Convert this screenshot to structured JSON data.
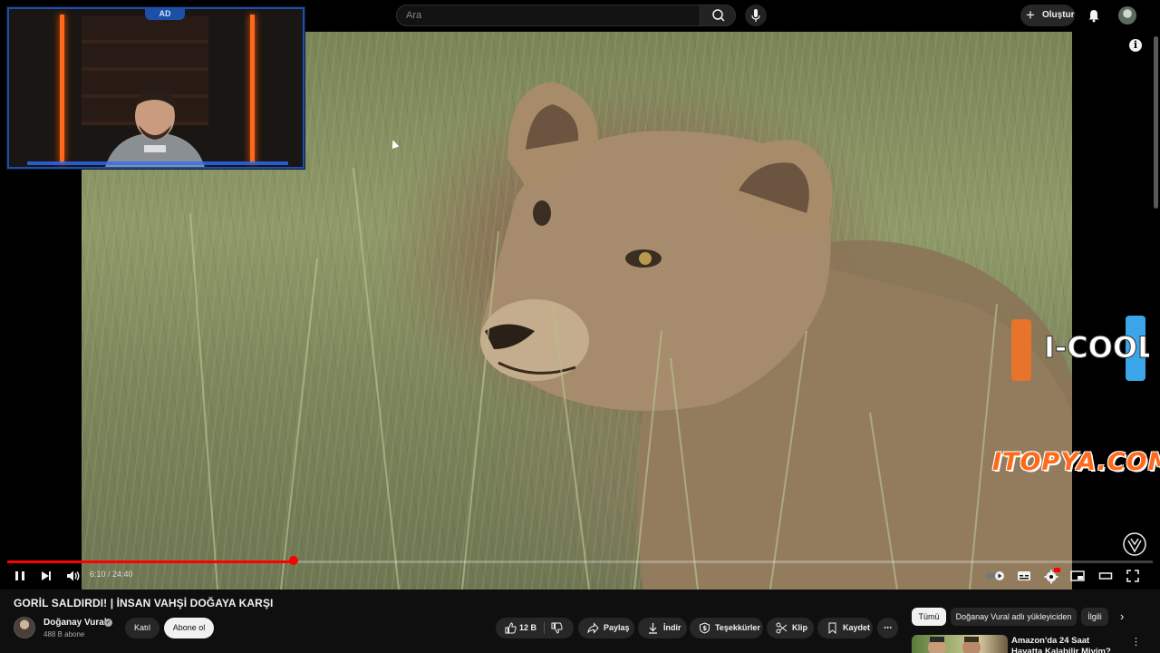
{
  "masthead": {
    "search_placeholder": "Ara",
    "create_label": "Oluştur",
    "create_icon": "plus-icon",
    "notifications_icon": "bell-icon"
  },
  "player": {
    "time_current": "6:10",
    "time_total": "24:40",
    "time_display": "6:10 / 24:40",
    "progress_fraction": 0.25,
    "accent_color": "#ff0000",
    "overlays": {
      "cam_logo": "AD",
      "sponsor_1": "I-COOL",
      "sponsor_2": "ITOPYA.COM"
    },
    "settings_badge": "HD"
  },
  "video": {
    "title": "GORİL SALDIRDI! | İNSAN VAHŞİ DOĞAYA KARŞI"
  },
  "channel": {
    "name": "Doğanay Vural",
    "subscribers": "488 B abone",
    "join_label": "Katıl",
    "subscribe_label": "Abone ol"
  },
  "actions": {
    "like_count": "12 B",
    "share": "Paylaş",
    "download": "İndir",
    "thanks": "Teşekkürler",
    "clip": "Klip",
    "save": "Kaydet",
    "more": "⋯"
  },
  "chips": [
    {
      "label": "Tümü",
      "active": true
    },
    {
      "label": "Doğanay Vural adlı yükleyiciden",
      "active": false
    },
    {
      "label": "İlgili",
      "active": false
    }
  ],
  "recommendation": {
    "title": "Amazon'da 24 Saat Hayatta Kalabilir Miyim?"
  }
}
